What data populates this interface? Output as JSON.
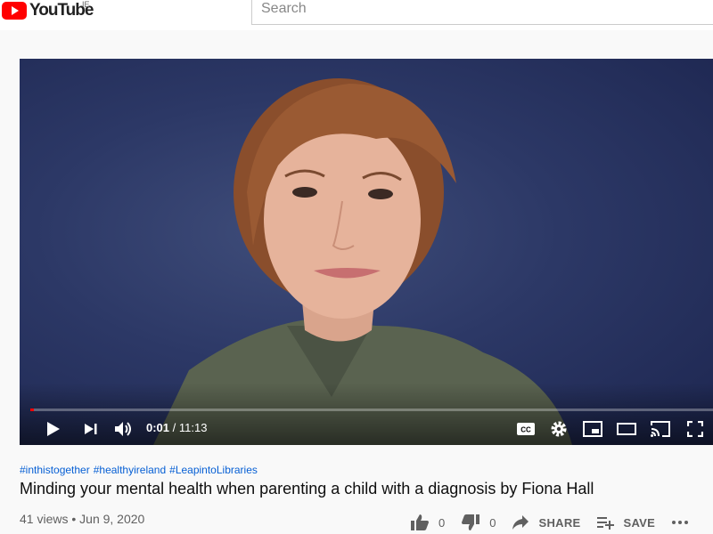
{
  "header": {
    "logo_text": "YouTube",
    "region": "IE",
    "search_placeholder": "Search"
  },
  "player": {
    "current_time": "0:01",
    "separator": " / ",
    "duration": "11:13",
    "progress_fraction": 0.002
  },
  "video": {
    "hashtags": [
      "#inthistogether",
      "#healthyireland",
      "#LeapintoLibraries"
    ],
    "title": "Minding your mental health when parenting a child with a diagnosis by Fiona Hall",
    "views": "41 views",
    "date": "Jun 9, 2020",
    "likes": "0",
    "dislikes": "0",
    "share_label": "SHARE",
    "save_label": "SAVE"
  },
  "icons": [
    "youtube-logo-icon",
    "play-icon",
    "next-icon",
    "volume-icon",
    "cc-icon",
    "settings-icon",
    "miniplayer-icon",
    "theater-icon",
    "cast-icon",
    "fullscreen-icon",
    "like-icon",
    "dislike-icon",
    "share-icon",
    "save-icon",
    "more-icon"
  ]
}
